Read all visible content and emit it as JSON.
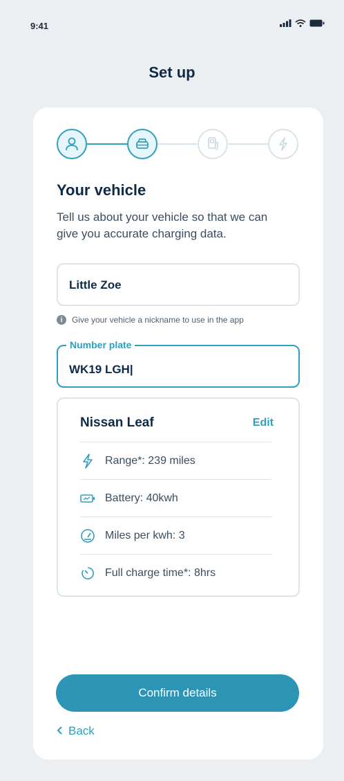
{
  "status_bar": {
    "time": "9:41"
  },
  "header": {
    "title": "Set up"
  },
  "stepper": {
    "steps": [
      {
        "icon": "person-icon",
        "state": "done"
      },
      {
        "icon": "car-icon",
        "state": "active"
      },
      {
        "icon": "charger-icon",
        "state": "inactive"
      },
      {
        "icon": "lightning-icon",
        "state": "inactive"
      }
    ]
  },
  "section": {
    "title": "Your vehicle",
    "description": "Tell us about your vehicle so that we can give you accurate charging data."
  },
  "nickname_field": {
    "value": "Little Zoe",
    "hint": "Give your vehicle a nickname to use in the app",
    "hint_icon": "info-icon"
  },
  "plate_field": {
    "label": "Number plate",
    "value": "WK19 LGH|"
  },
  "vehicle": {
    "name": "Nissan Leaf",
    "edit_label": "Edit",
    "specs": [
      {
        "icon": "lightning-icon",
        "text": "Range*: 239 miles"
      },
      {
        "icon": "battery-icon",
        "text": "Battery: 40kwh"
      },
      {
        "icon": "gauge-icon",
        "text": "Miles per kwh: 3"
      },
      {
        "icon": "timer-icon",
        "text": "Full charge time*: 8hrs"
      }
    ]
  },
  "actions": {
    "confirm_label": "Confirm details",
    "back_label": "Back"
  },
  "colors": {
    "accent": "#2f9fc0",
    "button": "#2c95b6",
    "title": "#0e2a47",
    "background": "#eceff2"
  }
}
